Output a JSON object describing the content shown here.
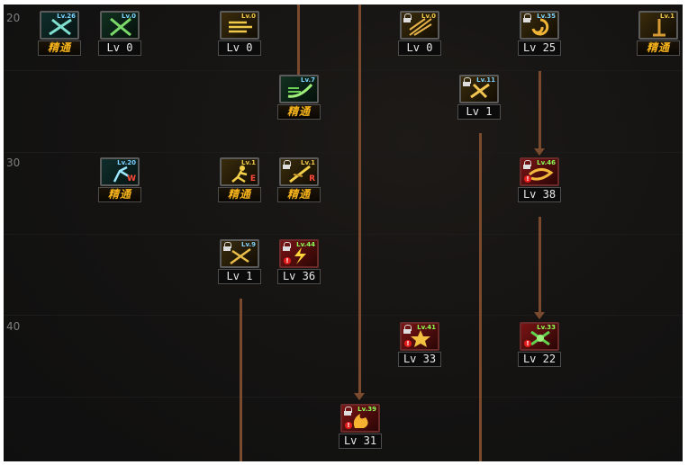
{
  "row_labels": [
    "20",
    "30",
    "40"
  ],
  "mastery_label": "精通",
  "skills": [
    {
      "tag": "Lv.26",
      "caption": "精通",
      "theme": "teal"
    },
    {
      "tag": "Lv.0",
      "caption": "Lv 0",
      "theme": "green"
    },
    {
      "tag": "Lv.0",
      "caption": "Lv 0",
      "theme": "gold"
    },
    {
      "tag": "Lv.7",
      "caption": "精通",
      "theme": "green"
    },
    {
      "tag": "Lv.0",
      "caption": "Lv 0",
      "theme": "gold"
    },
    {
      "tag": "Lv.11",
      "caption": "Lv 1",
      "theme": "gold"
    },
    {
      "tag": "Lv.35",
      "caption": "Lv 25",
      "theme": "gold"
    },
    {
      "tag": "Lv.1",
      "caption": "精通",
      "theme": "gold"
    },
    {
      "tag": "Lv.20",
      "caption": "精通",
      "theme": "teal",
      "letter": "W"
    },
    {
      "tag": "Lv.1",
      "caption": "精通",
      "theme": "gold",
      "letter": "E"
    },
    {
      "tag": "Lv.1",
      "caption": "精通",
      "theme": "gold",
      "letter": "R"
    },
    {
      "tag": "Lv.46",
      "caption": "Lv 38",
      "theme": "red"
    },
    {
      "tag": "Lv.9",
      "caption": "Lv 1",
      "theme": "gold"
    },
    {
      "tag": "Lv.44",
      "caption": "Lv 36",
      "theme": "red"
    },
    {
      "tag": "Lv.41",
      "caption": "Lv 33",
      "theme": "red"
    },
    {
      "tag": "Lv.33",
      "caption": "Lv 22",
      "theme": "red"
    },
    {
      "tag": "Lv.39",
      "caption": "Lv 31",
      "theme": "red"
    }
  ]
}
